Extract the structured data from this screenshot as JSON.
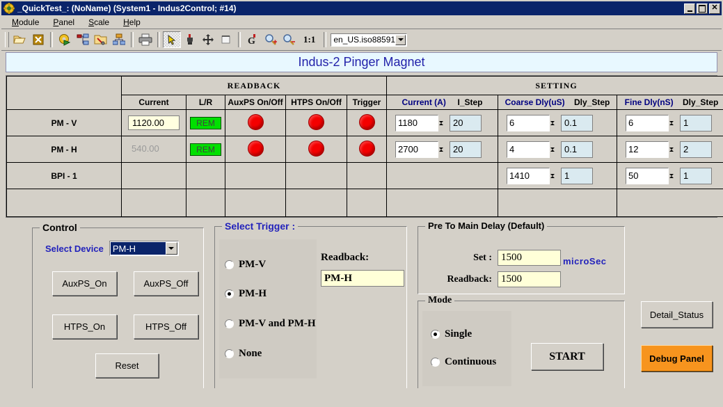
{
  "window": {
    "title": "_QuickTest_: (NoName) (System1 - Indus2Control; #14)",
    "app_icon": "gear-icon",
    "minimize_label": "",
    "maximize_label": "",
    "close_label": "✕"
  },
  "menubar": {
    "items": [
      {
        "label": "Module",
        "mnemonic": "M"
      },
      {
        "label": "Panel",
        "mnemonic": "P"
      },
      {
        "label": "Scale",
        "mnemonic": "S"
      },
      {
        "label": "Help",
        "mnemonic": "H"
      }
    ]
  },
  "toolbar": {
    "buttons": [
      {
        "name": "open-folder-icon"
      },
      {
        "name": "close-document-icon"
      },
      {
        "name": "run-settings-icon"
      },
      {
        "name": "network-node-icon"
      },
      {
        "name": "folder-tools-icon"
      },
      {
        "name": "hierarchy-icon"
      },
      {
        "name": "print-icon"
      },
      {
        "name": "pointer-icon"
      },
      {
        "name": "probe-icon"
      },
      {
        "name": "move-icon"
      },
      {
        "name": "select-region-icon"
      },
      {
        "name": "grab-icon"
      },
      {
        "name": "zoom-in-icon"
      },
      {
        "name": "zoom-out-icon"
      }
    ],
    "scale_label": "1:1",
    "locale_value": "en_US.iso88591"
  },
  "page": {
    "title": "Indus-2 Pinger Magnet"
  },
  "table": {
    "group_headers": [
      {
        "label": "READBACK",
        "color": "#fce9b8"
      },
      {
        "label": "SETTING",
        "color": "#fcd0fc"
      }
    ],
    "columns": {
      "readback": [
        "Current",
        "L/R",
        "AuxPS On/Off",
        "HTPS On/Off",
        "Trigger"
      ],
      "setting": [
        "Current (A)",
        "I_Step",
        "Coarse Dly(uS)",
        "Dly_Step",
        "Fine Dly(nS)",
        "Dly_Step"
      ]
    },
    "rows": [
      {
        "label": "PM - V",
        "readback": {
          "current": "1120.00",
          "current_dim": false,
          "lr": "REM",
          "auxps": "led-red",
          "htps": "led-red",
          "trigger": "led-red"
        },
        "setting": {
          "current": "1180",
          "i_step": "20",
          "coarse_dly": "6",
          "coarse_step": "0.1",
          "fine_dly": "6",
          "fine_step": "1"
        }
      },
      {
        "label": "PM - H",
        "readback": {
          "current": "540.00",
          "current_dim": true,
          "lr": "REM",
          "auxps": "led-red",
          "htps": "led-red",
          "trigger": "led-red"
        },
        "setting": {
          "current": "2700",
          "i_step": "20",
          "coarse_dly": "4",
          "coarse_step": "0.1",
          "fine_dly": "12",
          "fine_step": "2"
        }
      },
      {
        "label": "BPI - 1",
        "readback": {
          "current": "",
          "current_dim": true,
          "lr": "",
          "auxps": "",
          "htps": "",
          "trigger": ""
        },
        "setting": {
          "current": "",
          "i_step": "",
          "coarse_dly": "1410",
          "coarse_step": "1",
          "fine_dly": "50",
          "fine_step": "1"
        }
      },
      {
        "label": "",
        "readback": {
          "current": "",
          "current_dim": true,
          "lr": "",
          "auxps": "",
          "htps": "",
          "trigger": ""
        },
        "setting": {
          "current": "",
          "i_step": "",
          "coarse_dly": "",
          "coarse_step": "",
          "fine_dly": "",
          "fine_step": ""
        }
      }
    ]
  },
  "control": {
    "legend": "Control",
    "select_device_label": "Select Device",
    "select_device_value": "PM-H",
    "buttons": {
      "auxps_on": "AuxPS_On",
      "auxps_off": "AuxPS_Off",
      "htps_on": "HTPS_On",
      "htps_off": "HTPS_Off",
      "reset": "Reset"
    }
  },
  "select_trigger": {
    "legend": "Select Trigger :",
    "options": [
      {
        "label": "PM-V",
        "selected": false
      },
      {
        "label": "PM-H",
        "selected": true
      },
      {
        "label": "PM-V and PM-H",
        "selected": false
      },
      {
        "label": "None",
        "selected": false
      }
    ],
    "readback_label": "Readback:",
    "readback_value": "PM-H"
  },
  "pre_to_main_delay": {
    "legend": "Pre To Main Delay (Default)",
    "set_label": "Set :",
    "set_value": "1500",
    "readback_label": "Readback:",
    "readback_value": "1500",
    "unit": "microSec"
  },
  "mode": {
    "legend": "Mode",
    "options": [
      {
        "label": "Single",
        "selected": true
      },
      {
        "label": "Continuous",
        "selected": false
      }
    ],
    "start_label": "START"
  },
  "side_buttons": {
    "detail_status": "Detail_Status",
    "debug_panel": "Debug Panel",
    "debug_color": "#f7941e"
  }
}
